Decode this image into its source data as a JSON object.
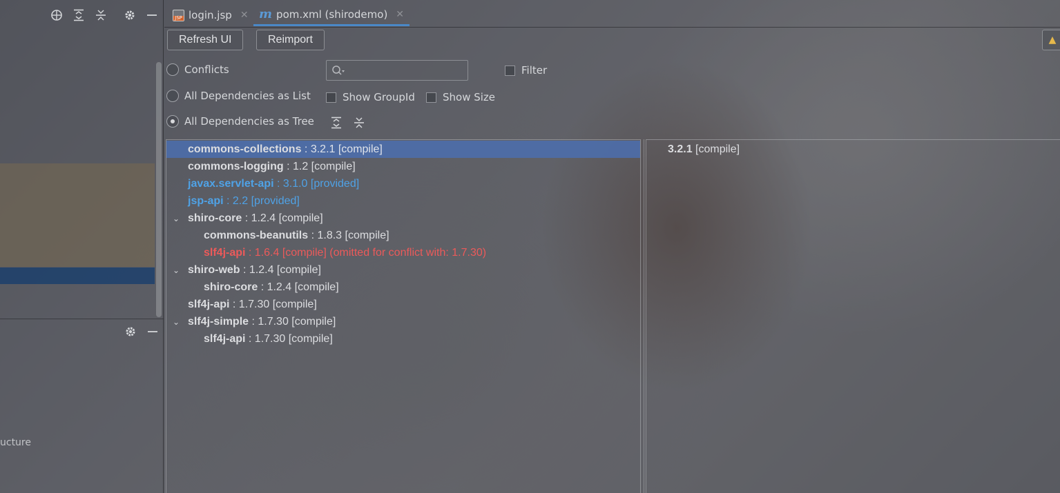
{
  "left_panel": {
    "icons": [
      "crosshair-icon",
      "expand-all-icon",
      "collapse-all-icon",
      "gear-icon",
      "minimize-icon"
    ],
    "bottom_icons": [
      "gear-icon",
      "minimize-icon"
    ],
    "structure_label": "ucture"
  },
  "tabs": [
    {
      "label": "login.jsp",
      "icon": "jsp-file-icon",
      "active": false
    },
    {
      "label": "pom.xml (shirodemo)",
      "icon": "maven-icon",
      "active": true
    }
  ],
  "toolbar": {
    "refresh_label": "Refresh UI",
    "reimport_label": "Reimport"
  },
  "view_options": {
    "conflicts_label": "Conflicts",
    "list_label": "All Dependencies as List",
    "tree_label": "All Dependencies as Tree",
    "selected": "tree",
    "filter_label": "Filter",
    "show_groupid_label": "Show GroupId",
    "show_size_label": "Show Size",
    "search_placeholder": ""
  },
  "tree": [
    {
      "name": "commons-collections",
      "rest": " : 3.2.1 [compile]",
      "depth": 0,
      "expanded": null,
      "style": "normal",
      "selected": true
    },
    {
      "name": "commons-logging",
      "rest": " : 1.2 [compile]",
      "depth": 0,
      "expanded": null,
      "style": "normal",
      "selected": false
    },
    {
      "name": "javax.servlet-api",
      "rest": " : 3.1.0 [provided]",
      "depth": 0,
      "expanded": null,
      "style": "provided",
      "selected": false
    },
    {
      "name": "jsp-api",
      "rest": " : 2.2 [provided]",
      "depth": 0,
      "expanded": null,
      "style": "provided",
      "selected": false
    },
    {
      "name": "shiro-core",
      "rest": " : 1.2.4 [compile]",
      "depth": 0,
      "expanded": true,
      "style": "normal",
      "selected": false
    },
    {
      "name": "commons-beanutils",
      "rest": " : 1.8.3 [compile]",
      "depth": 1,
      "expanded": null,
      "style": "normal",
      "selected": false
    },
    {
      "name": "slf4j-api",
      "rest": " : 1.6.4 [compile] (omitted for conflict with: 1.7.30)",
      "depth": 1,
      "expanded": null,
      "style": "conflict",
      "selected": false
    },
    {
      "name": "shiro-web",
      "rest": " : 1.2.4 [compile]",
      "depth": 0,
      "expanded": true,
      "style": "normal",
      "selected": false
    },
    {
      "name": "shiro-core",
      "rest": " : 1.2.4 [compile]",
      "depth": 1,
      "expanded": null,
      "style": "normal",
      "selected": false
    },
    {
      "name": "slf4j-api",
      "rest": " : 1.7.30 [compile]",
      "depth": 0,
      "expanded": null,
      "style": "normal",
      "selected": false
    },
    {
      "name": "slf4j-simple",
      "rest": " : 1.7.30 [compile]",
      "depth": 0,
      "expanded": true,
      "style": "normal",
      "selected": false
    },
    {
      "name": "slf4j-api",
      "rest": " : 1.7.30 [compile]",
      "depth": 1,
      "expanded": null,
      "style": "normal",
      "selected": false
    }
  ],
  "detail": {
    "version": "3.2.1",
    "scope": " [compile]"
  },
  "colors": {
    "selection": "#4b6eaf",
    "provided": "#4fa2e6",
    "conflict": "#ec5a5a",
    "active_tab_underline": "#4a88c7"
  }
}
